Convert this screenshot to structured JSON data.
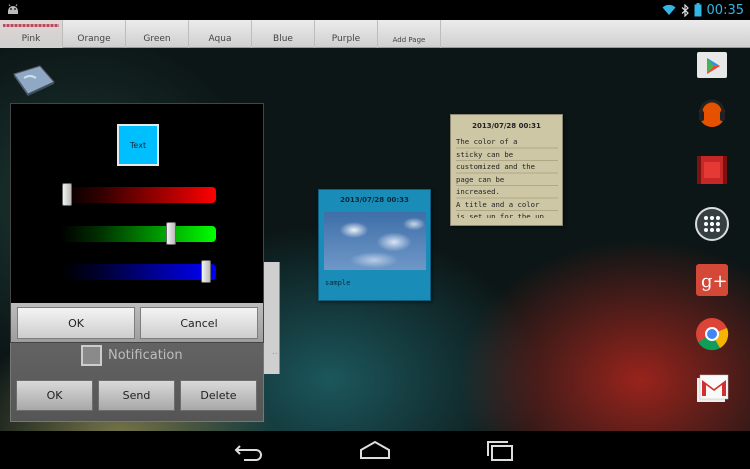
{
  "status_bar": {
    "time": "00:35",
    "left_icon": "android-debug-icon",
    "right_icons": [
      "wifi-icon",
      "bluetooth-icon",
      "battery-icon"
    ]
  },
  "tabs": {
    "items": [
      {
        "label": "Pink",
        "active": true
      },
      {
        "label": "Orange"
      },
      {
        "label": "Green"
      },
      {
        "label": "Aqua"
      },
      {
        "label": "Blue"
      },
      {
        "label": "Purple"
      },
      {
        "label": "Add Page"
      }
    ]
  },
  "notes": {
    "beige": {
      "date": "2013/07/28 00:31",
      "text": "The color of a\nsticky can be\ncustomized and the\npage can be\nincreased.\nA title and a color\nis set up for the up..."
    },
    "blue": {
      "date": "2013/07/28 00:33",
      "caption": "sample"
    }
  },
  "color_picker": {
    "preview_label": "Text",
    "preview_color": "#00bfff",
    "red": 0,
    "green": 0.75,
    "blue": 1.0,
    "ok_label": "OK",
    "cancel_label": "Cancel"
  },
  "edit_dialog": {
    "notification_label": "Notification",
    "notification_checked": false,
    "ellipsis": "...",
    "ok_label": "OK",
    "send_label": "Send",
    "delete_label": "Delete"
  },
  "dock": {
    "icons": [
      "play-store-icon",
      "play-music-icon",
      "play-movies-icon",
      "all-apps-icon",
      "google-plus-icon",
      "chrome-icon",
      "gmail-icon"
    ]
  },
  "nav_bar": {
    "icons": [
      "back-icon",
      "home-icon",
      "recent-apps-icon"
    ]
  },
  "colors": {
    "accent": "#33b5e5",
    "note_beige": "#cdc7a6",
    "note_blue": "#1a8cb8"
  }
}
